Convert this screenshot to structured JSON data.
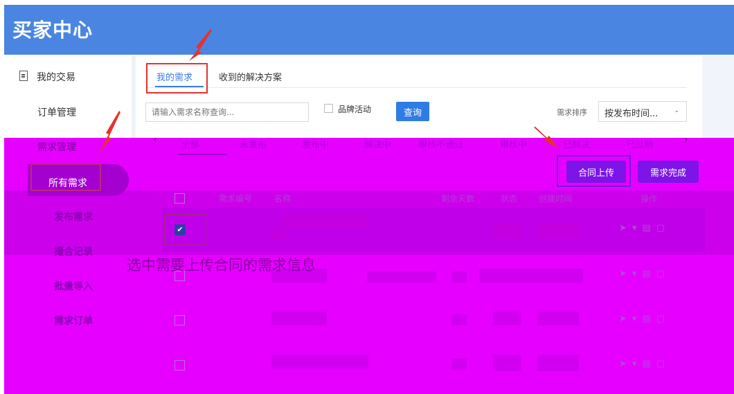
{
  "app": {
    "title": "买家中心"
  },
  "sidebar": {
    "my_trades": "我的交易",
    "order_management": "订单管理",
    "demand_management": "需求管理",
    "items": [
      "所有需求",
      "发布需求",
      "撮合记录",
      "批量导入",
      "需求订单"
    ]
  },
  "top_tabs": [
    "我的需求",
    "收到的解决方案"
  ],
  "search": {
    "placeholder": "请输入需求名称查询...",
    "brand_label": "品牌活动",
    "query_button": "查询"
  },
  "sort": {
    "label": "需求排序",
    "selected": "按发布时间..."
  },
  "status_tabs": [
    "全部",
    "未发布",
    "发布中",
    "解决中",
    "审核不通过",
    "审核中",
    "已解决",
    "已过期"
  ],
  "actions": {
    "upload_contract": "合同上传",
    "complete": "需求完成"
  },
  "table": {
    "headers": [
      "需求编号",
      "名称",
      "剩余天数",
      "状态",
      "创建时间",
      "操作"
    ]
  },
  "annotation": "选中需要上传合同的需求信息",
  "colors": {
    "header": "#4a86e1",
    "accent": "#2f7ce4",
    "overlay": "#e600ff",
    "callout": "#e8302c"
  }
}
